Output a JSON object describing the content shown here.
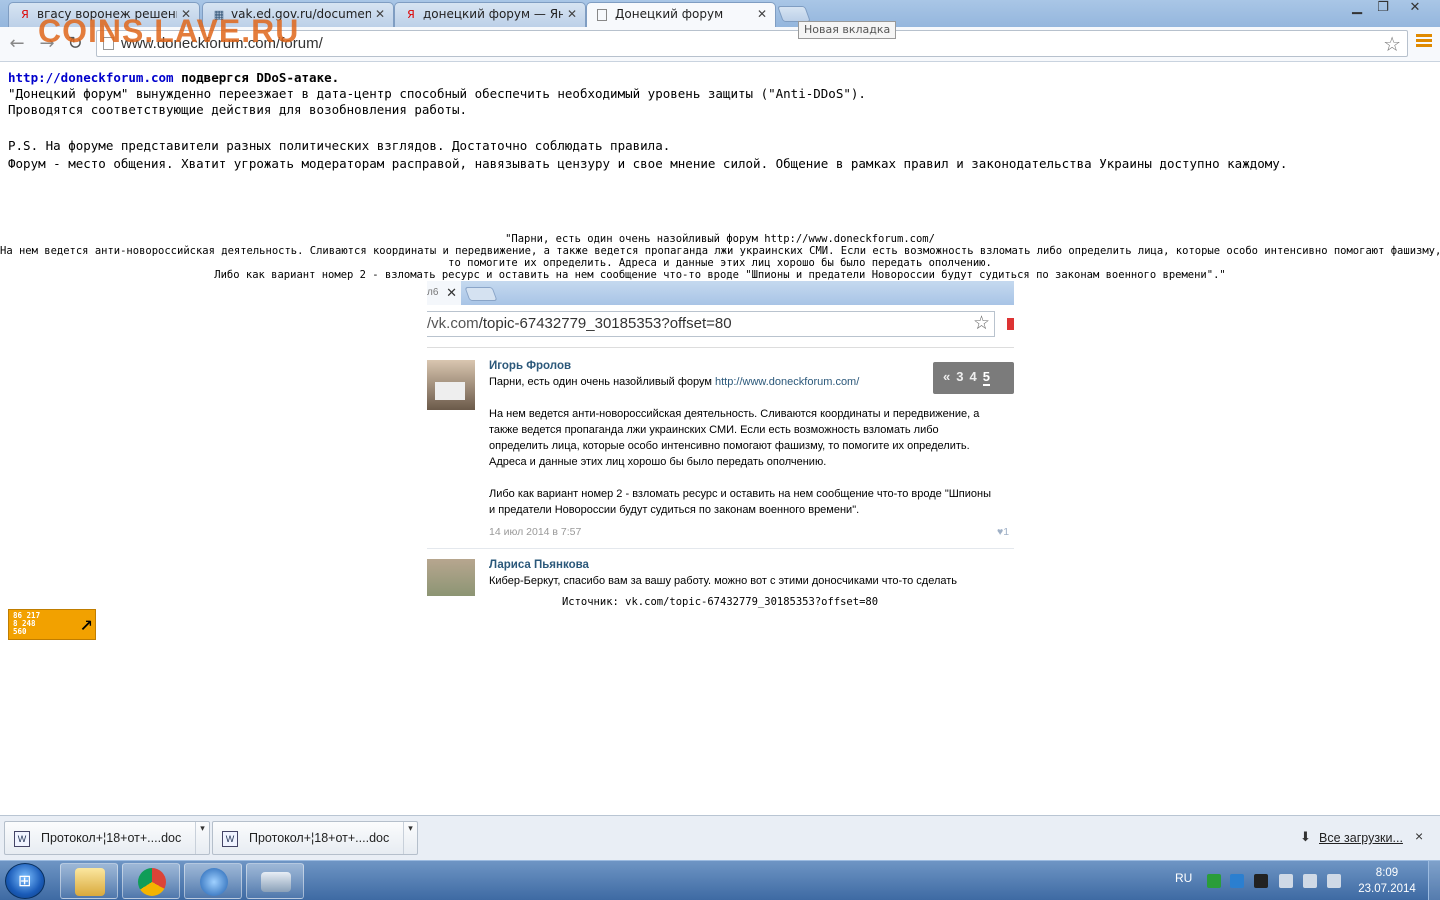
{
  "watermark": "COINS.LAVE.RU",
  "browser": {
    "tabs": [
      {
        "title": "вгасу воронеж решение",
        "icon": "Я"
      },
      {
        "title": "vak.ed.gov.ru/documents",
        "icon": "▦"
      },
      {
        "title": "донецкий форум — Янде",
        "icon": "Я"
      },
      {
        "title": "Донецкий форум",
        "icon": ""
      }
    ],
    "new_tab_tooltip": "Новая вкладка",
    "url": "www.doneckforum.com/forum/"
  },
  "page": {
    "notice_link": "http://doneckforum.com",
    "notice_headline": " подвергся DDoS-атаке.",
    "notice_line1": "\"Донецкий форум\" вынужденно переезжает в дата-центр способный обеспечить необходимый уровень защиты (\"Anti-DDoS\").",
    "notice_line2": "Проводятся соответствующие действия для возобновления работы.",
    "ps_line1": "P.S. На форуме представители разных политических взглядов. Достаточно соблюдать правила.",
    "ps_line2": "Форум - место общения. Хватит угрожать модераторам расправой, навязывать цензуру и свое мнение силой. Общение в рамках правил и законодательства Украины доступно каждому.",
    "quote_line1": "\"Парни, есть один очень назойливый форум http://www.doneckforum.com/",
    "quote_line2": "На нем ведется анти-новороссийская деятельность. Сливаются координаты и передвижение, а также ведется пропаганда лжи украинских СМИ. Если есть возможность взломать либо определить лица, которые особо интенсивно помогают фашизму,",
    "quote_line3": "то помогите их определить. Адреса и данные этих лиц хорошо бы было передать ополчению.",
    "quote_line4": "Либо как вариант номер 2 - взломать ресурс и оставить на нем сообщение что-то вроде \"Шпионы и предатели Новороссии будут судиться по законам военного времени\".\"",
    "source": "Источник: vk.com/topic-67432779_30185353?offset=80",
    "counter_nums": [
      "86 217",
      "8 248",
      "560"
    ]
  },
  "screenshot": {
    "tab_label": "л6",
    "url_host": "/vk.com",
    "url_path": "/topic-67432779_30185353?offset=80",
    "pager": {
      "prev": "«",
      "pages": [
        "3",
        "4"
      ],
      "current": "5"
    },
    "post1": {
      "author": "Игорь Фролов",
      "line1_text": "Парни, есть один очень назойливый форум ",
      "line1_link": "http://www.doneckforum.com/",
      "para2": "На нем ведется анти-новороссийская деятельность. Сливаются координаты и передвижение, а также ведется пропаганда лжи украинских СМИ. Если есть возможность взломать либо определить лица, которые особо интенсивно помогают фашизму, то помогите их определить. Адреса и данные этих лиц хорошо бы было передать ополчению.",
      "para3": "Либо как вариант номер 2 - взломать ресурс и оставить на нем сообщение что-то вроде \"Шпионы и предатели Новороссии будут судиться по законам военного времени\".",
      "date": "14 июл 2014 в 7:57",
      "likes": "1"
    },
    "post2": {
      "author": "Лариса Пьянкова",
      "text": "Кибер-Беркут, спасибо вам за вашу работу. можно вот с этими доносчиками что-то сделать"
    }
  },
  "downloads": {
    "items": [
      {
        "name": "Протокол+¦18+от+....doc"
      },
      {
        "name": "Протокол+¦18+от+....doc"
      }
    ],
    "all_label": "Все загрузки...",
    "close": "×"
  },
  "taskbar": {
    "lang": "RU",
    "time": "8:09",
    "date": "23.07.2014"
  }
}
